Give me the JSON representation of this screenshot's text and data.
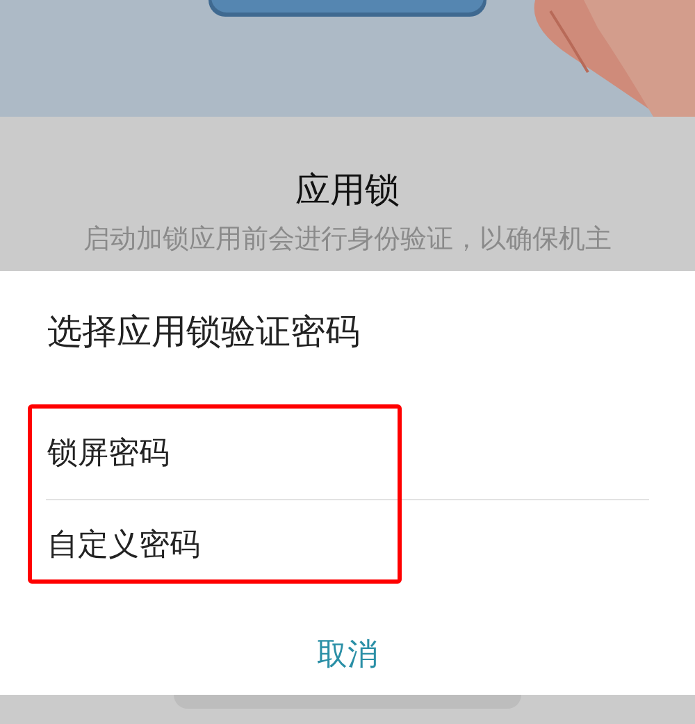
{
  "background": {
    "title": "应用锁",
    "description": "启动加锁应用前会进行身份验证，以确保机主"
  },
  "dialog": {
    "title": "选择应用锁验证密码",
    "options": [
      {
        "label": "锁屏密码"
      },
      {
        "label": "自定义密码"
      }
    ],
    "highlight": {
      "kind": "frame",
      "color": "#ff0000"
    },
    "buttons": [
      "取消"
    ]
  }
}
